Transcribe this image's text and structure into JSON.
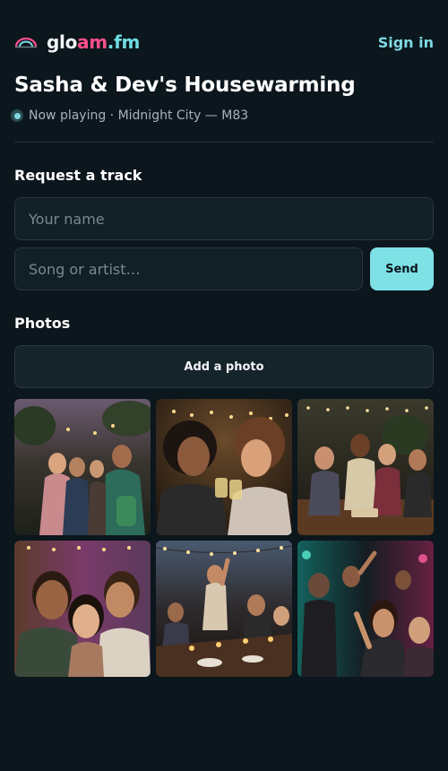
{
  "header": {
    "brand": {
      "part1": "glo",
      "part2": "am",
      "part3": ".fm",
      "logo_icon": "arch-sun-logo-icon"
    },
    "sign_in": "Sign in"
  },
  "party": {
    "title": "Sasha & Dev's Housewarming",
    "now_playing": "Now playing · Midnight City — M83"
  },
  "request": {
    "heading": "Request a track",
    "name_placeholder": "Your name",
    "name_value": "",
    "song_placeholder": "Song or artist…",
    "song_value": "",
    "send_label": "Send"
  },
  "photos": {
    "heading": "Photos",
    "add_label": "Add a photo",
    "items": [
      {
        "icon": "photo-backyard-group-hug"
      },
      {
        "icon": "photo-two-friends-toasting"
      },
      {
        "icon": "photo-friends-on-sofa-laughing"
      },
      {
        "icon": "photo-three-friends-selfie"
      },
      {
        "icon": "photo-dinner-table-dancing"
      },
      {
        "icon": "photo-dance-floor-crowd"
      }
    ]
  },
  "colors": {
    "background": "#0b161d",
    "accent": "#7ee1e6",
    "brand_pink": "#ff4f8b",
    "text": "#f2f5f7",
    "muted": "#a7b3bb"
  }
}
